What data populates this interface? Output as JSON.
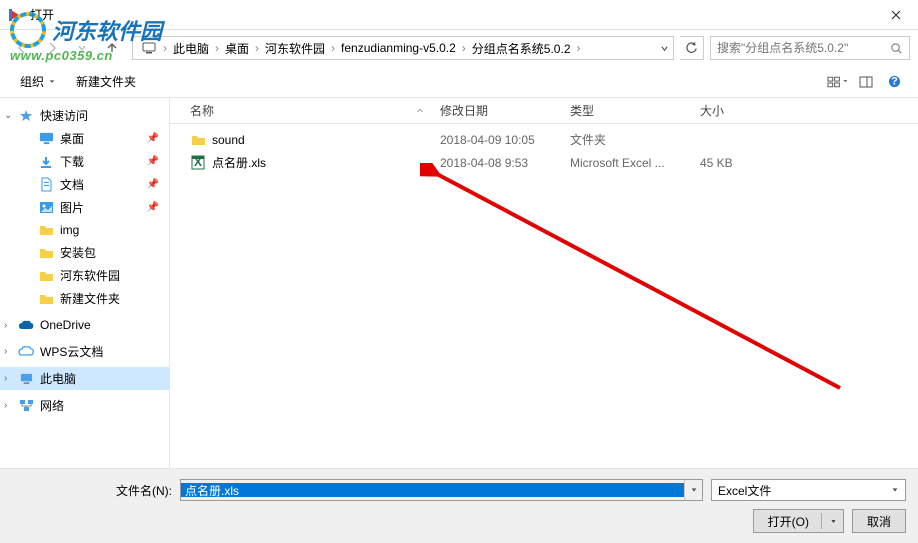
{
  "title": "打开",
  "watermark": {
    "brand": "河东软件园",
    "url": "www.pc0359.cn"
  },
  "breadcrumb": {
    "items": [
      "此电脑",
      "桌面",
      "河东软件园",
      "fenzudianming-v5.0.2",
      "分组点名系统5.0.2"
    ]
  },
  "search": {
    "placeholder": "搜索\"分组点名系统5.0.2\""
  },
  "toolbar": {
    "organize": "组织",
    "newfolder": "新建文件夹"
  },
  "sidebar": {
    "quick": {
      "label": "快速访问",
      "items": [
        {
          "label": "桌面",
          "icon": "desktop",
          "pinned": true
        },
        {
          "label": "下载",
          "icon": "download",
          "pinned": true
        },
        {
          "label": "文档",
          "icon": "document",
          "pinned": true
        },
        {
          "label": "图片",
          "icon": "picture",
          "pinned": true
        },
        {
          "label": "img",
          "icon": "folder",
          "pinned": false
        },
        {
          "label": "安装包",
          "icon": "folder",
          "pinned": false
        },
        {
          "label": "河东软件园",
          "icon": "folder",
          "pinned": false
        },
        {
          "label": "新建文件夹",
          "icon": "folder",
          "pinned": false
        }
      ]
    },
    "onedrive": "OneDrive",
    "wps": "WPS云文档",
    "thispc": "此电脑",
    "network": "网络"
  },
  "columns": {
    "name": "名称",
    "date": "修改日期",
    "type": "类型",
    "size": "大小"
  },
  "files": [
    {
      "name": "sound",
      "date": "2018-04-09 10:05",
      "type": "文件夹",
      "size": "",
      "icon": "folder"
    },
    {
      "name": "点名册.xls",
      "date": "2018-04-08 9:53",
      "type": "Microsoft Excel ...",
      "size": "45 KB",
      "icon": "excel"
    }
  ],
  "footer": {
    "filename_label": "文件名(N):",
    "filename_value": "点名册.xls",
    "filter": "Excel文件",
    "open": "打开(O)",
    "cancel": "取消"
  }
}
